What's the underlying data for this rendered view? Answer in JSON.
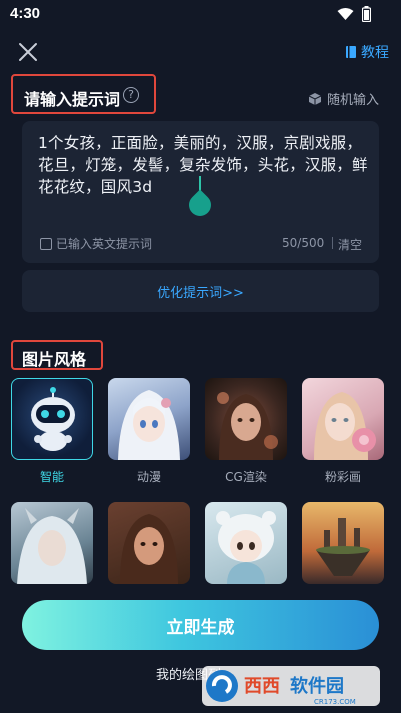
{
  "status": {
    "time": "4:30"
  },
  "header": {
    "tutorial_label": "教程"
  },
  "prompt": {
    "title": "请输入提示词",
    "help_glyph": "?",
    "random_label": "随机输入",
    "text": "1个女孩，正面脸，美丽的，汉服，京剧戏服，花旦，灯笼，发髻，复杂发饰，头花，汉服，鲜花花纹，国风3d",
    "english_checkbox_label": "已输入英文提示词",
    "char_count": "50/500",
    "clear_label": "清空",
    "optimize_label": "优化提示词>>"
  },
  "styles": {
    "title": "图片风格",
    "items": [
      {
        "label": "智能",
        "selected": true
      },
      {
        "label": "动漫"
      },
      {
        "label": "CG渲染"
      },
      {
        "label": "粉彩画"
      },
      {
        "label": ""
      },
      {
        "label": ""
      },
      {
        "label": ""
      },
      {
        "label": ""
      }
    ]
  },
  "actions": {
    "generate_label": "立即生成",
    "my_drawings_label": "我的绘图列"
  },
  "watermark": {
    "text": "西西软件园",
    "sub": "CR173.COM"
  },
  "colors": {
    "accent": "#3aa8ff",
    "highlight_border": "#e0473c",
    "selected": "#3fd8e6"
  }
}
